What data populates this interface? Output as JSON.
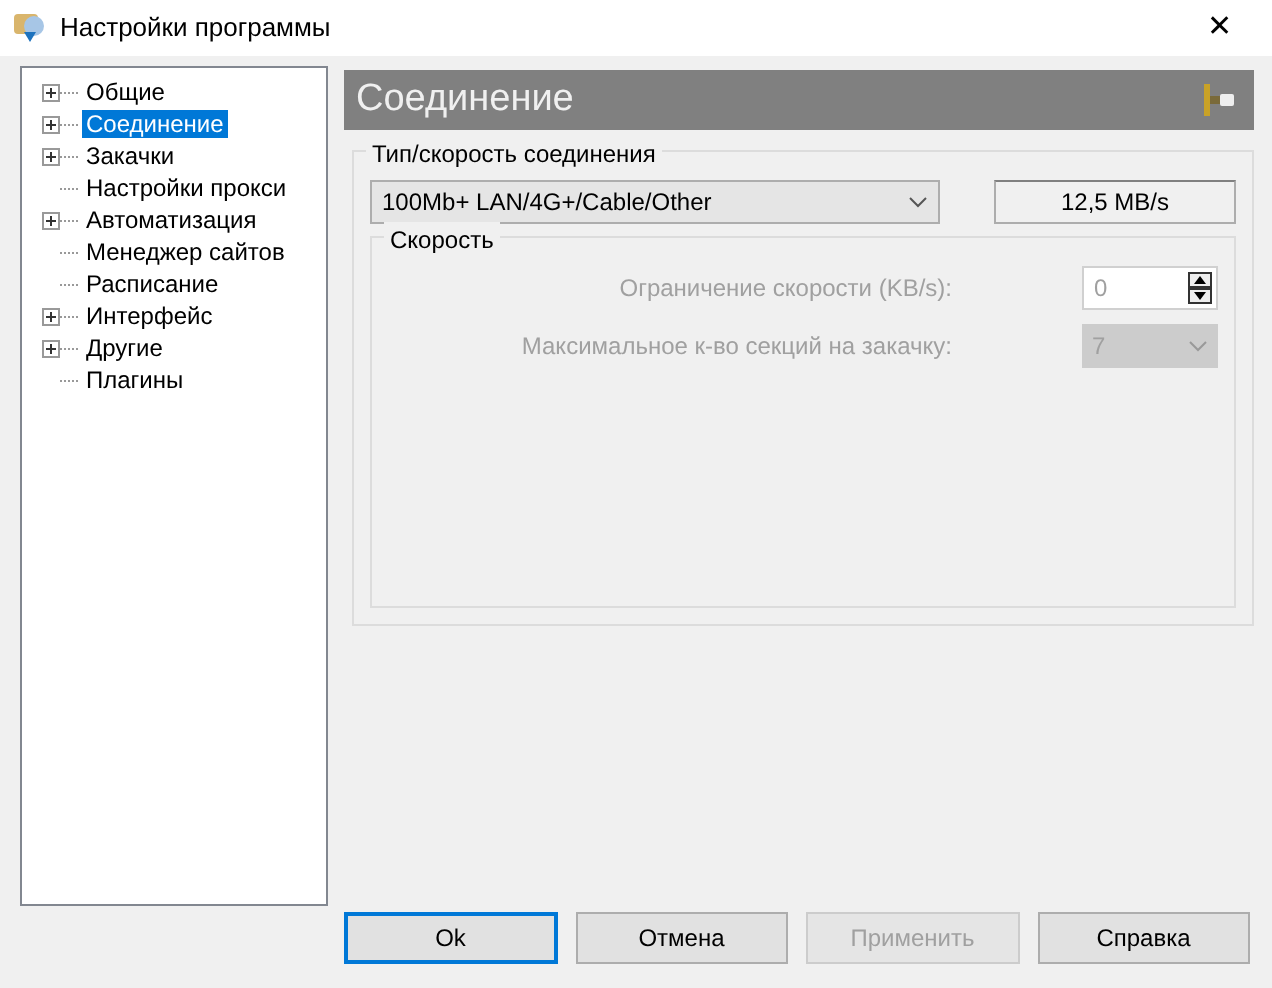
{
  "window": {
    "title": "Настройки программы",
    "close": "✕"
  },
  "tree": [
    {
      "label": "Общие",
      "expandable": true,
      "selected": false
    },
    {
      "label": "Соединение",
      "expandable": true,
      "selected": true
    },
    {
      "label": "Закачки",
      "expandable": true,
      "selected": false
    },
    {
      "label": "Настройки прокси",
      "expandable": false,
      "selected": false
    },
    {
      "label": "Автоматизация",
      "expandable": true,
      "selected": false
    },
    {
      "label": "Менеджер сайтов",
      "expandable": false,
      "selected": false
    },
    {
      "label": "Расписание",
      "expandable": false,
      "selected": false
    },
    {
      "label": "Интерфейс",
      "expandable": true,
      "selected": false
    },
    {
      "label": "Другие",
      "expandable": true,
      "selected": false
    },
    {
      "label": "Плагины",
      "expandable": false,
      "selected": false
    }
  ],
  "header": {
    "title": "Соединение"
  },
  "connection_group": {
    "legend": "Тип/скорость соединения",
    "type_value": "100Mb+  LAN/4G+/Cable/Other",
    "speed_readout": "12,5 MB/s"
  },
  "speed_group": {
    "legend": "Скорость",
    "disabled": true,
    "rows": [
      {
        "kind": "spin",
        "label": "Ограничение скорости (KB/s):",
        "value": "0"
      },
      {
        "kind": "combo",
        "label": "Максимальное к-во секций на закачку:",
        "value": "7"
      }
    ]
  },
  "buttons": [
    {
      "label": "Ok",
      "default": true,
      "disabled": false
    },
    {
      "label": "Отмена",
      "default": false,
      "disabled": false
    },
    {
      "label": "Применить",
      "default": false,
      "disabled": true
    },
    {
      "label": "Справка",
      "default": false,
      "disabled": false
    }
  ]
}
